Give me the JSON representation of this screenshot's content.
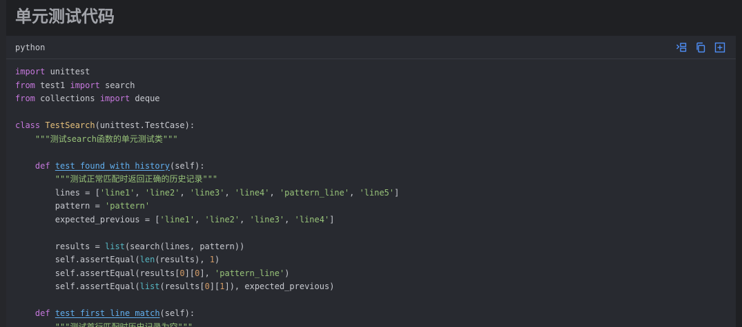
{
  "heading": "单元测试代码",
  "code_block": {
    "language": "python",
    "actions": [
      {
        "name": "wrap-icon",
        "title": "wrap"
      },
      {
        "name": "copy-icon",
        "title": "copy"
      },
      {
        "name": "expand-icon",
        "title": "expand"
      }
    ],
    "lines": [
      [
        {
          "t": "import",
          "c": "kw"
        },
        {
          "t": " unittest",
          "c": ""
        }
      ],
      [
        {
          "t": "from",
          "c": "kw"
        },
        {
          "t": " test1 ",
          "c": ""
        },
        {
          "t": "import",
          "c": "kw"
        },
        {
          "t": " search",
          "c": ""
        }
      ],
      [
        {
          "t": "from",
          "c": "kw"
        },
        {
          "t": " collections ",
          "c": ""
        },
        {
          "t": "import",
          "c": "kw"
        },
        {
          "t": " deque",
          "c": ""
        }
      ],
      [],
      [
        {
          "t": "class",
          "c": "kw"
        },
        {
          "t": " ",
          "c": ""
        },
        {
          "t": "TestSearch",
          "c": "cls"
        },
        {
          "t": "(unittest.TestCase):",
          "c": ""
        }
      ],
      [
        {
          "t": "    ",
          "c": ""
        },
        {
          "t": "\"\"\"测试search函数的单元测试类\"\"\"",
          "c": "str"
        }
      ],
      [],
      [
        {
          "t": "    ",
          "c": ""
        },
        {
          "t": "def",
          "c": "kw"
        },
        {
          "t": " ",
          "c": ""
        },
        {
          "t": "test_found_with_history",
          "c": "fn"
        },
        {
          "t": "(self):",
          "c": ""
        }
      ],
      [
        {
          "t": "        ",
          "c": ""
        },
        {
          "t": "\"\"\"测试正常匹配时返回正确的历史记录\"\"\"",
          "c": "str"
        }
      ],
      [
        {
          "t": "        lines = [",
          "c": ""
        },
        {
          "t": "'line1'",
          "c": "str"
        },
        {
          "t": ", ",
          "c": ""
        },
        {
          "t": "'line2'",
          "c": "str"
        },
        {
          "t": ", ",
          "c": ""
        },
        {
          "t": "'line3'",
          "c": "str"
        },
        {
          "t": ", ",
          "c": ""
        },
        {
          "t": "'line4'",
          "c": "str"
        },
        {
          "t": ", ",
          "c": ""
        },
        {
          "t": "'pattern_line'",
          "c": "str"
        },
        {
          "t": ", ",
          "c": ""
        },
        {
          "t": "'line5'",
          "c": "str"
        },
        {
          "t": "]",
          "c": ""
        }
      ],
      [
        {
          "t": "        pattern = ",
          "c": ""
        },
        {
          "t": "'pattern'",
          "c": "str"
        }
      ],
      [
        {
          "t": "        expected_previous = [",
          "c": ""
        },
        {
          "t": "'line1'",
          "c": "str"
        },
        {
          "t": ", ",
          "c": ""
        },
        {
          "t": "'line2'",
          "c": "str"
        },
        {
          "t": ", ",
          "c": ""
        },
        {
          "t": "'line3'",
          "c": "str"
        },
        {
          "t": ", ",
          "c": ""
        },
        {
          "t": "'line4'",
          "c": "str"
        },
        {
          "t": "]",
          "c": ""
        }
      ],
      [],
      [
        {
          "t": "        results = ",
          "c": ""
        },
        {
          "t": "list",
          "c": "bi"
        },
        {
          "t": "(search(lines, pattern))",
          "c": ""
        }
      ],
      [
        {
          "t": "        self.assertEqual(",
          "c": ""
        },
        {
          "t": "len",
          "c": "bi"
        },
        {
          "t": "(results), ",
          "c": ""
        },
        {
          "t": "1",
          "c": "num"
        },
        {
          "t": ")",
          "c": ""
        }
      ],
      [
        {
          "t": "        self.assertEqual(results[",
          "c": ""
        },
        {
          "t": "0",
          "c": "num"
        },
        {
          "t": "][",
          "c": ""
        },
        {
          "t": "0",
          "c": "num"
        },
        {
          "t": "], ",
          "c": ""
        },
        {
          "t": "'pattern_line'",
          "c": "str"
        },
        {
          "t": ")",
          "c": ""
        }
      ],
      [
        {
          "t": "        self.assertEqual(",
          "c": ""
        },
        {
          "t": "list",
          "c": "bi"
        },
        {
          "t": "(results[",
          "c": ""
        },
        {
          "t": "0",
          "c": "num"
        },
        {
          "t": "][",
          "c": ""
        },
        {
          "t": "1",
          "c": "num"
        },
        {
          "t": "]), expected_previous)",
          "c": ""
        }
      ],
      [],
      [
        {
          "t": "    ",
          "c": ""
        },
        {
          "t": "def",
          "c": "kw"
        },
        {
          "t": " ",
          "c": ""
        },
        {
          "t": "test_first_line_match",
          "c": "fn"
        },
        {
          "t": "(self):",
          "c": ""
        }
      ],
      [
        {
          "t": "        ",
          "c": ""
        },
        {
          "t": "\"\"\"测试首行匹配时历史记录为空\"\"\"",
          "c": "str"
        }
      ]
    ]
  },
  "colors": {
    "background": "#1f2023",
    "panel": "#282a30",
    "heading": "#a2a4aa",
    "keyword": "#c678dd",
    "class_name": "#e5c07b",
    "function_name": "#61afef",
    "string": "#98c379",
    "number": "#d19a66",
    "builtin": "#56b6c2",
    "icon_accent": "#4f8ff7"
  }
}
